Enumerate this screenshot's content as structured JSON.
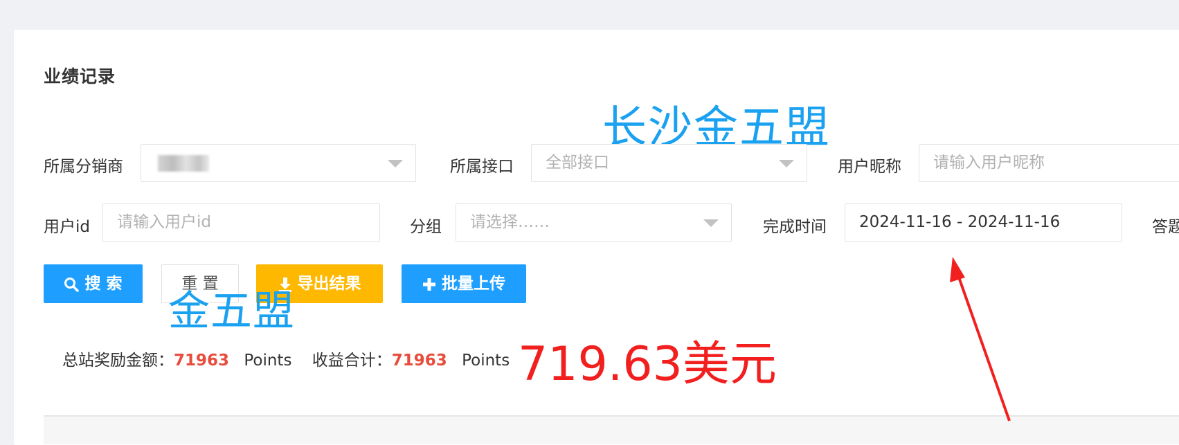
{
  "page_title": "业绩记录",
  "watermarks": {
    "top": "长沙金五盟",
    "middle": "金五盟"
  },
  "filters": {
    "distributor": {
      "label": "所属分销商",
      "value": ""
    },
    "interface": {
      "label": "所属接口",
      "value": "全部接口"
    },
    "nickname": {
      "label": "用户昵称",
      "placeholder": "请输入用户昵称"
    },
    "user_id": {
      "label": "用户id",
      "placeholder": "请输入用户id"
    },
    "group": {
      "label": "分组",
      "placeholder": "请选择……"
    },
    "finish_time": {
      "label": "完成时间",
      "value": "2024-11-16 - 2024-11-16"
    },
    "answer_cut": {
      "label": "答题"
    }
  },
  "buttons": {
    "search": "搜 索",
    "reset": "重 置",
    "export": "导出结果",
    "batch_upload": "批量上传"
  },
  "stats": {
    "total_reward_label": "总站奖励金额：",
    "total_reward_value": "71963",
    "unit": "Points",
    "income_label": "收益合计：",
    "income_value": "71963"
  },
  "annotation_amount": "719.63美元",
  "colors": {
    "primary": "#1e9fff",
    "warning": "#ffb800",
    "stat_red": "#e74c3c",
    "annotation_red": "#f21f1f",
    "watermark_blue": "#1aa1f0"
  }
}
